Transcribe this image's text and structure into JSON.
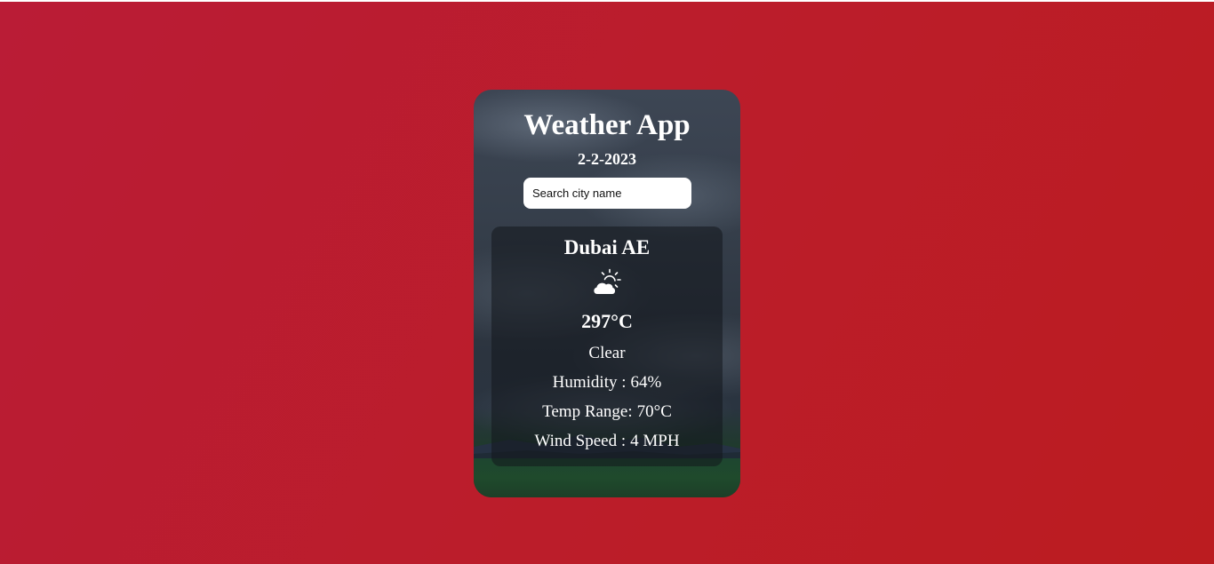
{
  "app": {
    "title": "Weather App",
    "date": "2-2-2023"
  },
  "search": {
    "placeholder": "Search city name",
    "value": ""
  },
  "weather": {
    "city": "Dubai AE",
    "icon": "partly-cloudy-icon",
    "temperature": "297°C",
    "condition": "Clear",
    "humidity_label": "Humidity :",
    "humidity_value": "64%",
    "temp_range_label": "Temp Range:",
    "temp_range_value": "70°C",
    "wind_label": "Wind Speed :",
    "wind_value": "4 MPH"
  },
  "colors": {
    "background_start": "#ba1c36",
    "background_end": "#bb1c20",
    "text": "#ffffff",
    "panel": "rgba(18, 22, 28, 0.55)"
  }
}
